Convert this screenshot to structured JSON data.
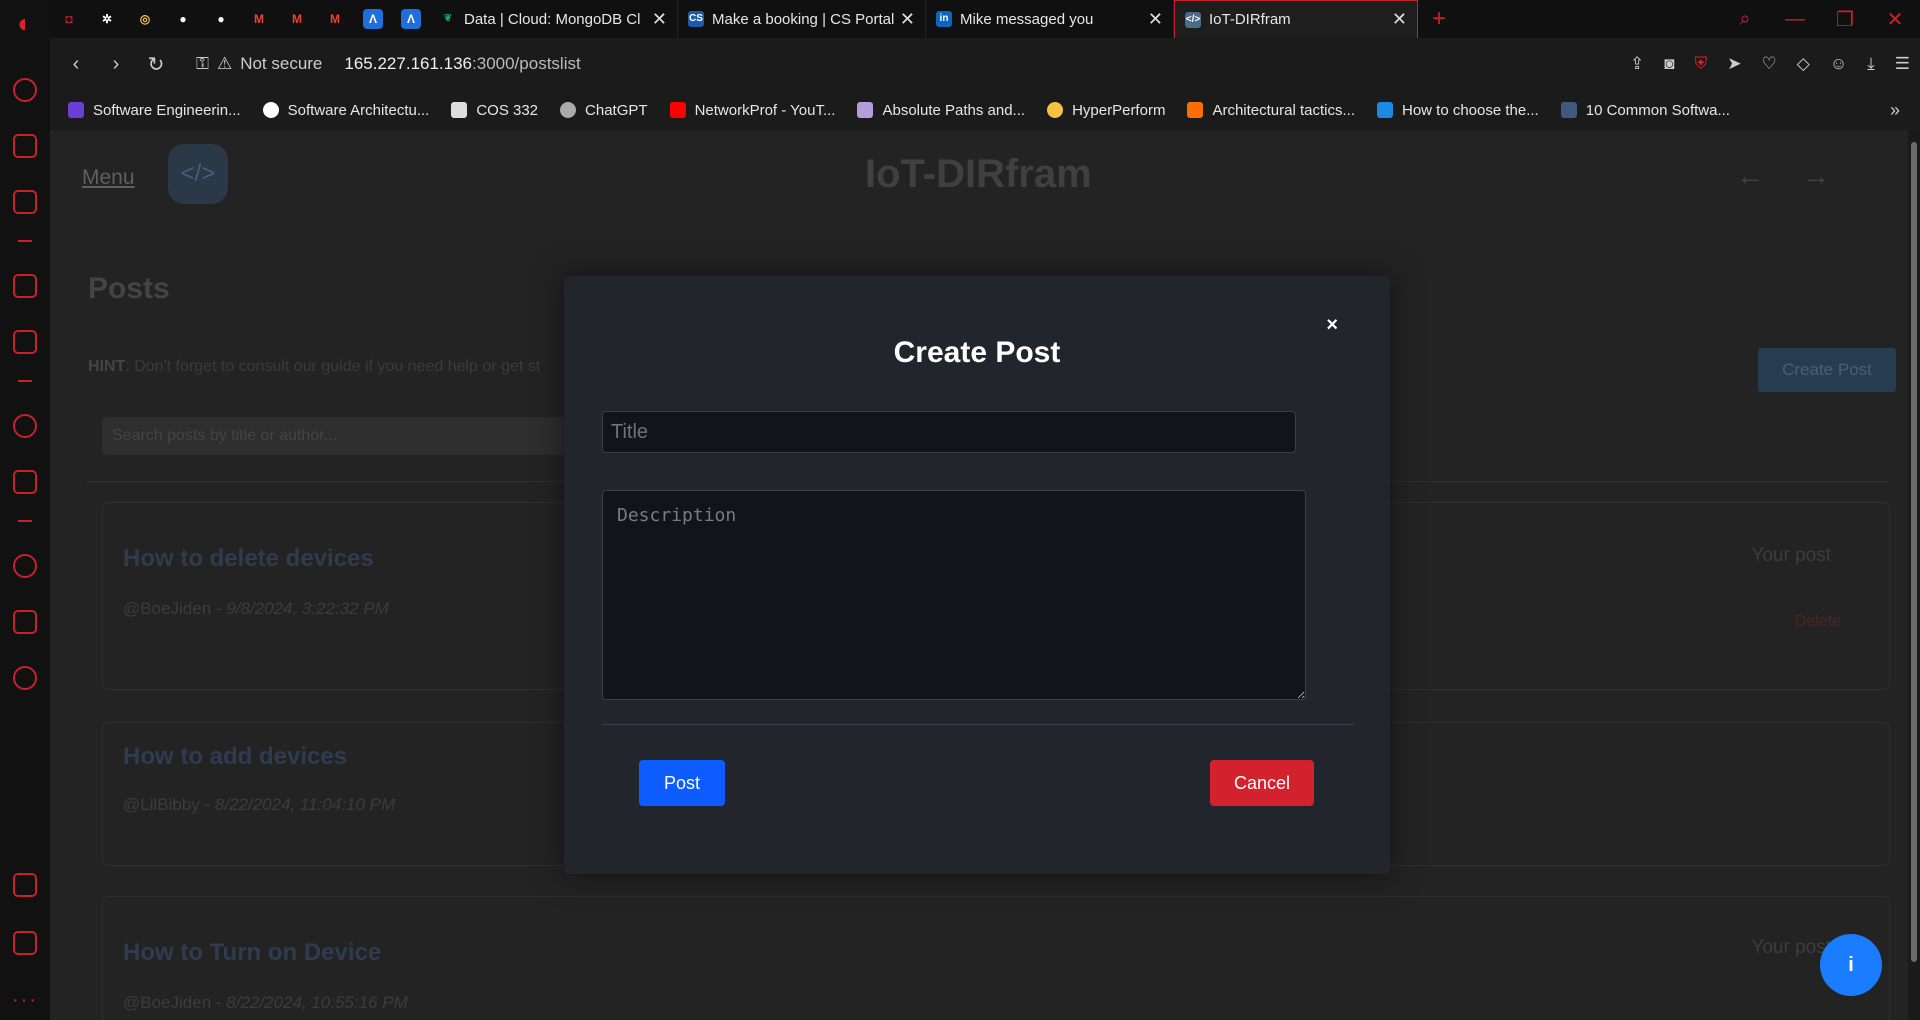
{
  "browser": {
    "tabs": [
      {
        "title": "Data | Cloud: MongoDB Cl",
        "favicon": "mongodb-leaf"
      },
      {
        "title": "Make a booking | CS Portal",
        "favicon": "cs-logo"
      },
      {
        "title": "Mike messaged you",
        "favicon": "linkedin-logo"
      },
      {
        "title": "IoT-DIRfram",
        "favicon": "code-logo"
      }
    ],
    "security_label": "Not secure",
    "url_host": "165.227.161.136",
    "url_path": ":3000/postslist",
    "bookmarks": [
      {
        "label": "Software Engineerin...",
        "color": "#6b3fd6"
      },
      {
        "label": "Software Architectu...",
        "color": "#ffffff"
      },
      {
        "label": "COS 332",
        "color": "#dddddd"
      },
      {
        "label": "ChatGPT",
        "color": "#aaaaaa"
      },
      {
        "label": "NetworkProf - YouT...",
        "color": "#ff0000"
      },
      {
        "label": "Absolute Paths and...",
        "color": "#b39ddb"
      },
      {
        "label": "HyperPerform",
        "color": "#f5c242"
      },
      {
        "label": "Architectural tactics...",
        "color": "#ff6d00"
      },
      {
        "label": "How to choose the...",
        "color": "#1e88e5"
      },
      {
        "label": "10 Common Softwa...",
        "color": "#3d5a80"
      }
    ]
  },
  "page": {
    "menu_label": "Menu",
    "brand_title": "IoT-DIRfram",
    "heading": "Posts",
    "hint_bold": "HINT",
    "hint_text": ": Don't forget to consult our guide if you need help or get st",
    "create_post_label": "Create Post",
    "search_placeholder": "Search posts by title or author...",
    "posts": [
      {
        "title": "How to delete devices",
        "author": "@BoeJiden",
        "date": "9/8/2024, 3:22:32 PM",
        "badge": "Your post",
        "delete": "Delete"
      },
      {
        "title": "How to add devices",
        "author": "@LilBibby",
        "date": "8/22/2024, 11:04:10 PM",
        "badge": "",
        "delete": ""
      },
      {
        "title": "How to Turn on Device",
        "author": "@BoeJiden",
        "date": "8/22/2024, 10:55:16 PM",
        "badge": "Your post",
        "delete": ""
      }
    ],
    "fab_label": "i"
  },
  "modal": {
    "title": "Create Post",
    "close": "×",
    "title_placeholder": "Title",
    "description_placeholder": "Description",
    "post_label": "Post",
    "cancel_label": "Cancel"
  },
  "colors": {
    "accent": "#c9202a",
    "primary_button": "#0d5cff",
    "danger_button": "#d3222d"
  }
}
